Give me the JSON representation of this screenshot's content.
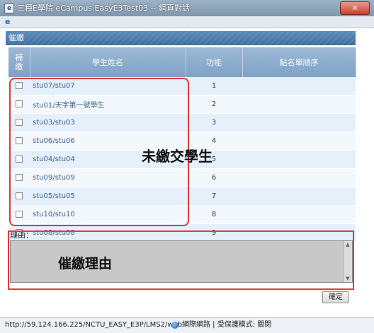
{
  "window": {
    "title": "三種E學院 eCampus EasyE3Test03 -- 網頁對話",
    "close_label": "✕"
  },
  "panel": {
    "header": "催繳"
  },
  "table": {
    "headers": {
      "pay": "補\n繳",
      "name": "學生姓名",
      "function": "功能",
      "order": "點名單順序"
    },
    "rows": [
      {
        "name": "stu07/stu07",
        "order": "1"
      },
      {
        "name": "stu01/天字第一號學生",
        "order": "2"
      },
      {
        "name": "stu03/stu03",
        "order": "3"
      },
      {
        "name": "stu06/stu06",
        "order": "4"
      },
      {
        "name": "stu04/stu04",
        "order": "5"
      },
      {
        "name": "stu09/stu09",
        "order": "6"
      },
      {
        "name": "stu05/stu05",
        "order": "7"
      },
      {
        "name": "stu10/stu10",
        "order": "8"
      },
      {
        "name": "stu08/stu08",
        "order": "9"
      }
    ]
  },
  "reason": {
    "label": "理由：",
    "value": ""
  },
  "annotations": {
    "students": "未繳交學生",
    "reason": "催繳理由"
  },
  "buttons": {
    "ok_label": "確定"
  },
  "statusbar": {
    "url": "http://59.124.166.225/NCTU_EASY_E3P/LMS2/web",
    "zone": "網際網路 | 受保護模式: 關閉"
  }
}
